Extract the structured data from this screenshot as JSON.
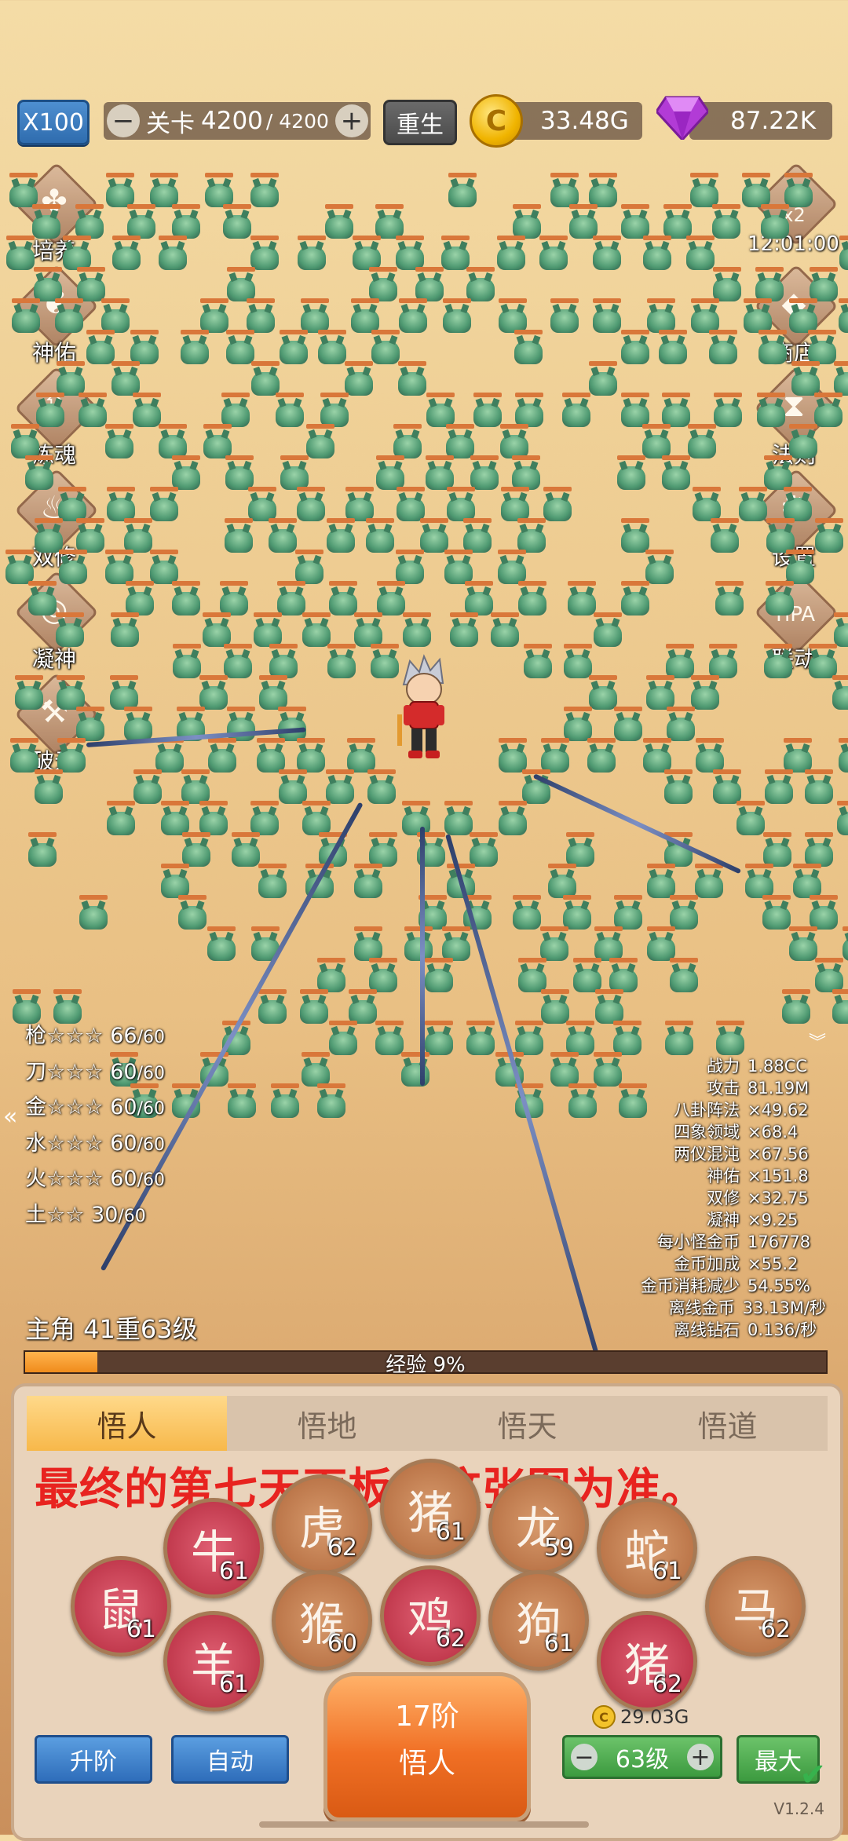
{
  "topbar": {
    "speed": "X100",
    "stage_label": "关卡",
    "stage_current": "4200",
    "stage_total": "/ 4200",
    "rebirth": "重生",
    "gold": "33.48G",
    "gems": "87.22K"
  },
  "left_menu": [
    "培养",
    "神佑",
    "炼魂",
    "双修",
    "凝神",
    "破元"
  ],
  "right_menu": {
    "bonus": "x2",
    "timer": "12:01:00",
    "items": [
      "商店",
      "法则",
      "设置",
      "联动"
    ]
  },
  "weapons": [
    {
      "name": "枪",
      "stars": "☆☆☆",
      "level": "66",
      "max": "/60"
    },
    {
      "name": "刀",
      "stars": "☆☆☆",
      "level": "60",
      "max": "/60"
    },
    {
      "name": "金",
      "stars": "☆☆☆",
      "level": "60",
      "max": "/60"
    },
    {
      "name": "水",
      "stars": "☆☆☆",
      "level": "60",
      "max": "/60"
    },
    {
      "name": "火",
      "stars": "☆☆☆",
      "level": "60",
      "max": "/60"
    },
    {
      "name": "土",
      "stars": "☆☆",
      "level": "30",
      "max": "/60"
    }
  ],
  "stats": [
    {
      "k": "战力",
      "v": "1.88CC"
    },
    {
      "k": "攻击",
      "v": "81.19M"
    },
    {
      "k": "八卦阵法",
      "v": "×49.62"
    },
    {
      "k": "四象领域",
      "v": "×68.4"
    },
    {
      "k": "两仪混沌",
      "v": "×67.56"
    },
    {
      "k": "神佑",
      "v": "×151.8"
    },
    {
      "k": "双修",
      "v": "×32.75"
    },
    {
      "k": "凝神",
      "v": "×9.25"
    },
    {
      "k": "每小怪金币",
      "v": "176778"
    },
    {
      "k": "金币加成",
      "v": "×55.2"
    },
    {
      "k": "金币消耗减少",
      "v": "54.55%"
    },
    {
      "k": "离线金币",
      "v": "33.13M/秒"
    },
    {
      "k": "离线钻石",
      "v": "0.136/秒"
    }
  ],
  "hero": {
    "level_text": "主角 41重63级",
    "exp_text": "经验 9%",
    "exp_fraction": 0.09
  },
  "panel": {
    "tabs": [
      "悟人",
      "悟地",
      "悟天",
      "悟道"
    ],
    "notice": "最终的第七天面板以这张图为准。",
    "zodiacs": [
      {
        "animal": "鼠",
        "level": "61"
      },
      {
        "animal": "牛",
        "level": "61"
      },
      {
        "animal": "羊",
        "level": "61"
      },
      {
        "animal": "虎",
        "level": "62"
      },
      {
        "animal": "猴",
        "level": "60"
      },
      {
        "animal": "猪",
        "level": "61"
      },
      {
        "animal": "鸡",
        "level": "62"
      },
      {
        "animal": "龙",
        "level": "59"
      },
      {
        "animal": "狗",
        "level": "61"
      },
      {
        "animal": "蛇",
        "level": "61"
      },
      {
        "animal": "猪",
        "level": "62"
      },
      {
        "animal": "马",
        "level": "62"
      }
    ],
    "main_button_line1": "17阶",
    "main_button_line2": "悟人",
    "upgrade": "升阶",
    "auto": "自动",
    "cost": "29.03G",
    "level_select": "63级",
    "max": "最大",
    "version": "V1.2.4"
  }
}
